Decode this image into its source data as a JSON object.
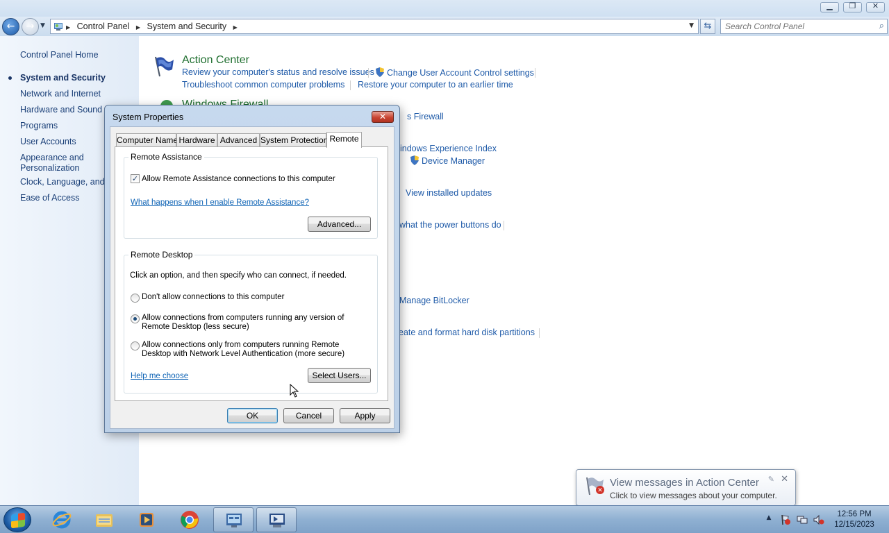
{
  "window": {
    "minimize_icon": "minimize-icon",
    "maximize_icon": "restore-icon",
    "close_icon": "close-icon"
  },
  "address_bar": {
    "breadcrumbs": [
      "Control Panel",
      "System and Security"
    ],
    "search_placeholder": "Search Control Panel"
  },
  "sidebar": {
    "items": [
      {
        "label": "Control Panel Home"
      },
      {
        "label": "System and Security",
        "selected": true
      },
      {
        "label": "Network and Internet"
      },
      {
        "label": "Hardware and Sound"
      },
      {
        "label": "Programs"
      },
      {
        "label": "User Accounts"
      },
      {
        "label": "Appearance and\nPersonalization"
      },
      {
        "label": "Clock, Language, and R"
      },
      {
        "label": "Ease of Access"
      }
    ]
  },
  "main": {
    "action_center": {
      "title": "Action Center",
      "links": [
        "Review your computer's status and resolve issues",
        "Change User Account Control settings",
        "Troubleshoot common computer problems",
        "Restore your computer to an earlier time"
      ]
    },
    "windows_firewall_title": "Windows Firewall",
    "partial_links": [
      "s Firewall",
      "indows Experience Index",
      "Device Manager",
      "View installed updates",
      "what the power buttons do",
      "Manage BitLocker",
      "eate and format hard disk partitions"
    ]
  },
  "dialog": {
    "title": "System Properties",
    "tabs": [
      "Computer Name",
      "Hardware",
      "Advanced",
      "System Protection",
      "Remote"
    ],
    "active_tab": "Remote",
    "remote_assistance": {
      "group_label": "Remote Assistance",
      "checkbox_label": "Allow Remote Assistance connections to this computer",
      "checkbox_checked": true,
      "help_link": "What happens when I enable Remote Assistance?",
      "advanced_button": "Advanced..."
    },
    "remote_desktop": {
      "group_label": "Remote Desktop",
      "instruction": "Click an option, and then specify who can connect, if needed.",
      "options": [
        {
          "line1": "Don't allow connections to this computer",
          "line2": "",
          "selected": false
        },
        {
          "line1": "Allow connections from computers running any version of",
          "line2": "Remote Desktop (less secure)",
          "selected": true
        },
        {
          "line1": "Allow connections only from computers running Remote",
          "line2": "Desktop with Network Level Authentication (more secure)",
          "selected": false
        }
      ],
      "help_link": "Help me choose",
      "select_users_button": "Select Users..."
    },
    "buttons": {
      "ok": "OK",
      "cancel": "Cancel",
      "apply": "Apply"
    }
  },
  "notification": {
    "title": "View messages in Action Center",
    "text": "Click to view messages about your computer."
  },
  "taskbar": {
    "apps": [
      "internet-explorer-icon",
      "file-explorer-icon",
      "media-player-icon",
      "chrome-icon",
      "control-panel-icon",
      "system-properties-icon"
    ],
    "time": "12:56 PM",
    "date": "12/15/2023"
  },
  "colors": {
    "link": "#1e5aa8",
    "heading_green": "#1e6e2e",
    "dialog_frame": "#c6d9ee",
    "close_red": "#c94432"
  }
}
